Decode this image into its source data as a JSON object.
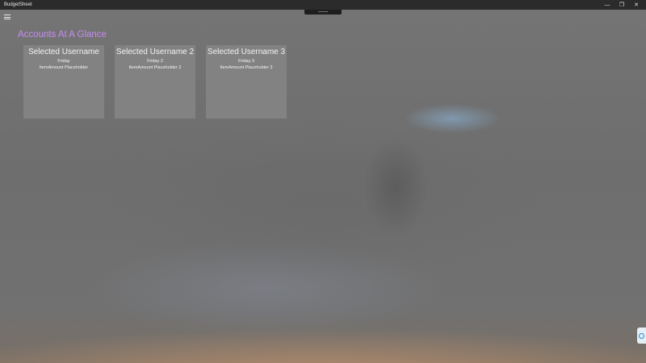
{
  "window": {
    "title": "BudgetSheet",
    "minimize_glyph": "—",
    "restore_glyph": "❐",
    "close_glyph": "✕"
  },
  "page": {
    "heading": "Accounts At A Glance"
  },
  "cards": [
    {
      "username": "Selected Username",
      "day": "Friday",
      "amount": "ItemAmount Placeholder"
    },
    {
      "username": "Selected Username 2",
      "day": "Friday 2",
      "amount": "ItemAmount Placeholder 2"
    },
    {
      "username": "Selected Username 3",
      "day": "Friday 3",
      "amount": "ItemAmount Placeholder 3"
    }
  ],
  "colors": {
    "heading_accent": "#c58cf0",
    "titlebar": "#2b2b2b",
    "card_bg": "#828282"
  },
  "icons": {
    "menu": "hamburger-menu-icon",
    "side_widget": "teamviewer-icon"
  }
}
